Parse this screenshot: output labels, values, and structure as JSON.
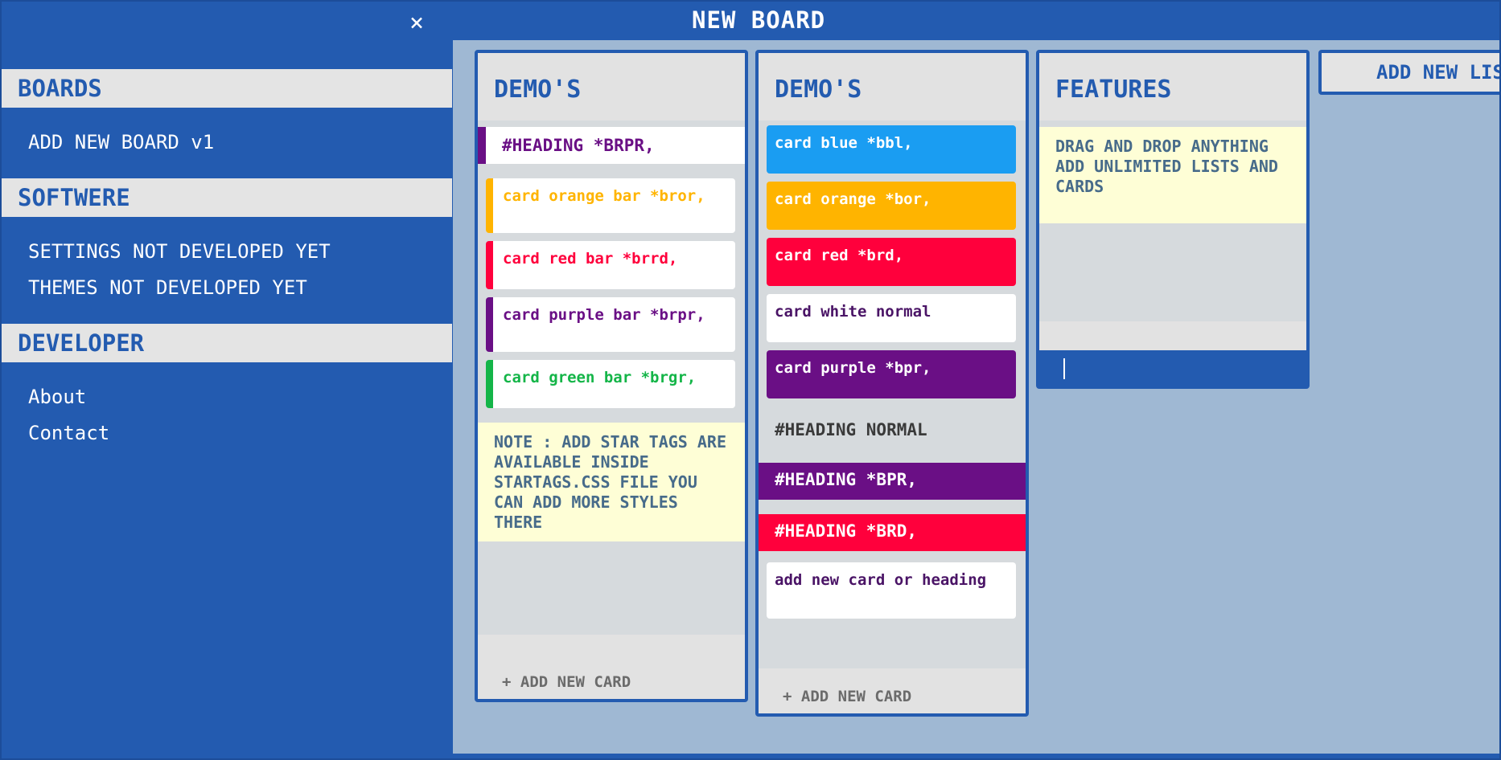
{
  "header": {
    "title": "NEW BOARD",
    "close_icon": "close-icon"
  },
  "sidebar": {
    "boards": {
      "label": "BOARDS",
      "items": [
        "ADD NEW BOARD v1"
      ]
    },
    "software": {
      "label": "SOFTWERE",
      "items": [
        "SETTINGS NOT DEVELOPED YET",
        "THEMES NOT DEVELOPED YET"
      ]
    },
    "developer": {
      "label": "DEVELOPER",
      "items": [
        "About",
        "Contact"
      ]
    }
  },
  "lists": [
    {
      "title": "DEMO'S",
      "heading": "#HEADING *BRPR,",
      "cards": [
        "card orange bar *bror,",
        "card red bar *brrd,",
        "card purple bar *brpr,",
        "card green bar *brgr,"
      ],
      "note": "NOTE : ADD STAR TAGS ARE AVAILABLE INSIDE STARTAGS.CSS FILE YOU CAN ADD MORE STYLES THERE",
      "add_card": "+ ADD NEW CARD"
    },
    {
      "title": "DEMO'S",
      "cards": [
        "card blue *bbl,",
        "card orange *bor,",
        "card red *brd,",
        "card white normal",
        "card purple *bpr,"
      ],
      "headings": [
        "#HEADING NORMAL",
        "#HEADING *BPR,",
        "#HEADING *BRD,"
      ],
      "last_card": "add new card or heading",
      "add_card": "+ ADD NEW CARD"
    },
    {
      "title": "FEATURES",
      "note": "DRAG AND DROP ANYTHING ADD UNLIMITED LISTS AND CARDS",
      "input_value": ""
    }
  ],
  "add_list": "ADD NEW LIST",
  "colors": {
    "brand": "#235bb0",
    "purple": "#6a0f85",
    "orange": "#ffb400",
    "red": "#ff003c",
    "green": "#14b548",
    "blue": "#1a9df2",
    "note_bg": "#fefed6"
  }
}
